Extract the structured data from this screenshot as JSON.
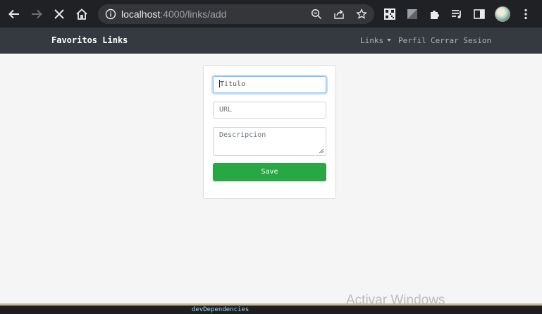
{
  "browser": {
    "url_host": "localhost",
    "url_path": ":4000/links/add"
  },
  "app": {
    "brand": "Favoritos Links",
    "nav": {
      "links_label": "Links",
      "profile_label": "Perfil",
      "logout_label": "Cerrar Sesion"
    }
  },
  "form": {
    "title_placeholder": "Titulo",
    "url_placeholder": "URL",
    "description_placeholder": "Descripcion",
    "save_label": "Save"
  },
  "watermark": "Activar Windows",
  "background_window": {
    "text": "devDependencies"
  },
  "colors": {
    "navbar": "#343a40",
    "save_button": "#28a745",
    "focus_border": "#80bdff",
    "page_background": "#f5f5f5"
  }
}
